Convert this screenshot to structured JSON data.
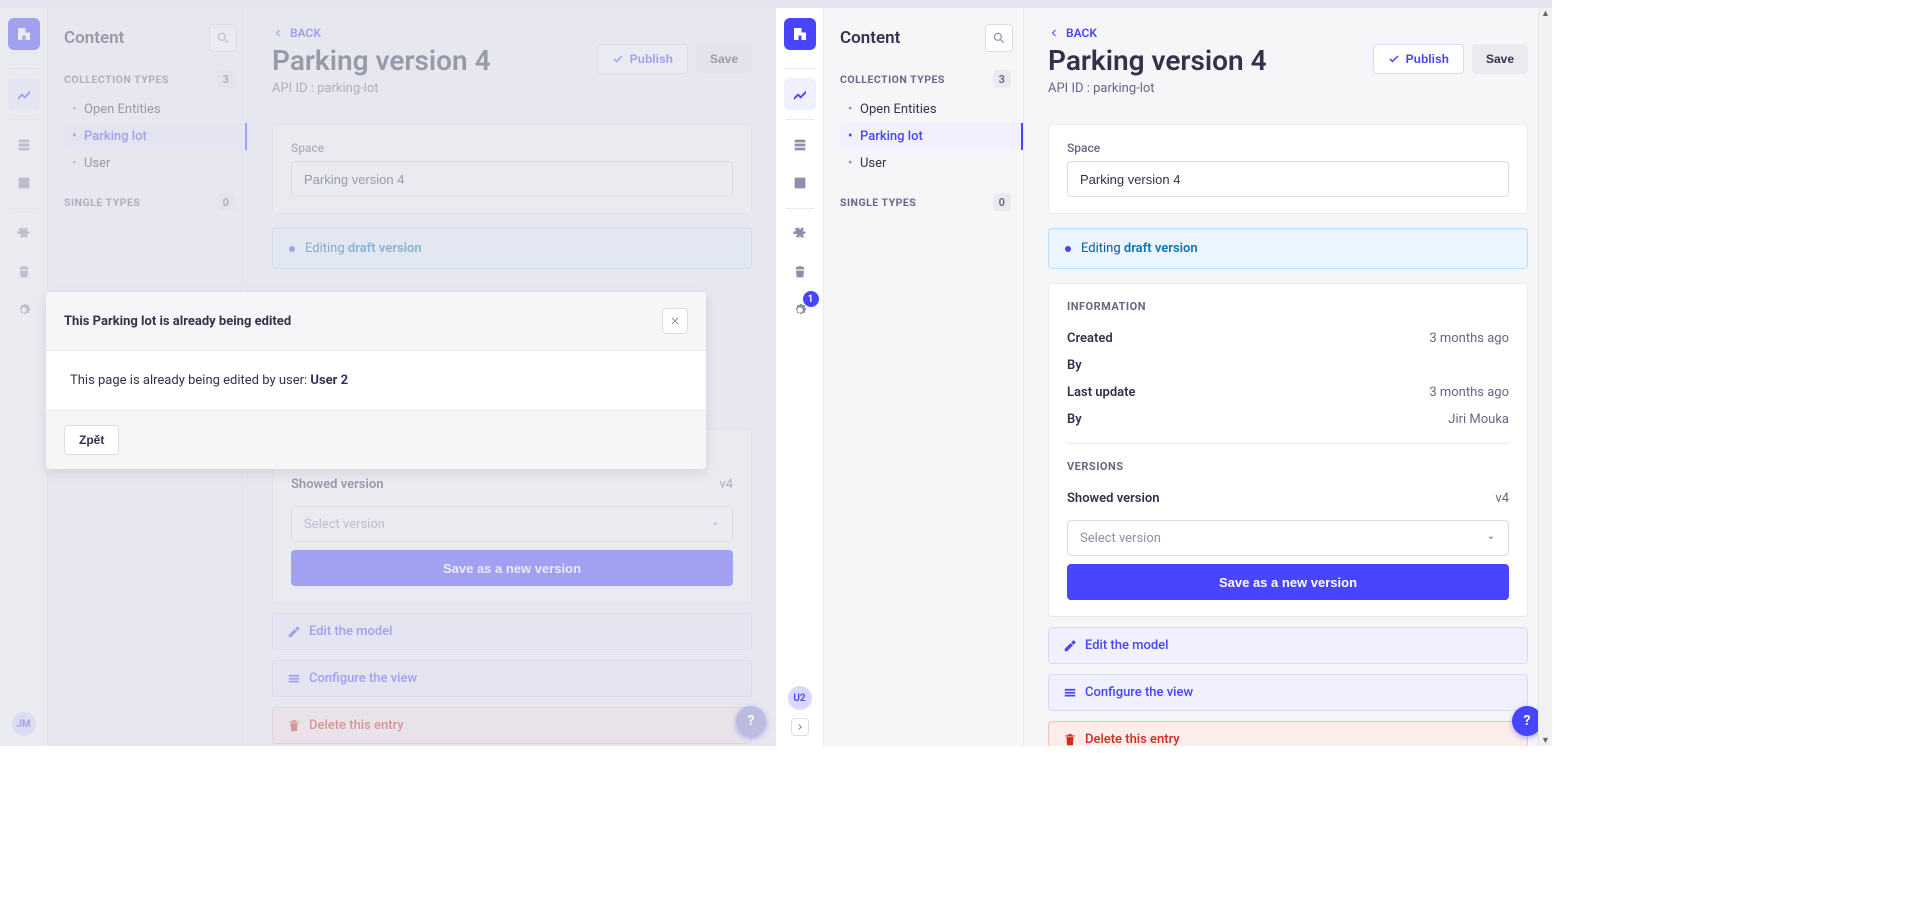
{
  "brand": {
    "color": "#4945ff"
  },
  "sidebar": {
    "title": "Content",
    "sections": {
      "collection": {
        "label": "Collection Types",
        "count": "3"
      },
      "single": {
        "label": "Single Types",
        "count": "0"
      }
    },
    "items": [
      {
        "label": "Open Entities"
      },
      {
        "label": "Parking lot"
      },
      {
        "label": "User"
      }
    ]
  },
  "rail": {
    "settings_badge": "1",
    "left_avatar": "JM",
    "right_avatar": "U2"
  },
  "header": {
    "back": "BACK",
    "title": "Parking version 4",
    "api_id_label": "API ID : ",
    "api_id_value": "parking-lot",
    "publish": "Publish",
    "save": "Save"
  },
  "form": {
    "space_label": "Space",
    "space_value": "Parking version 4"
  },
  "banner": {
    "prefix": "Editing ",
    "status": "draft version"
  },
  "info": {
    "section": "Information",
    "created_label": "Created",
    "created_value": "3 months ago",
    "created_by_label": "By",
    "created_by_value": "",
    "updated_label": "Last update",
    "updated_value": "3 months ago",
    "updated_by_label": "By",
    "updated_by_value": "Jiri Mouka"
  },
  "versions": {
    "section": "Versions",
    "showed_label": "Showed version",
    "showed_value": "v4",
    "select_placeholder": "Select version",
    "save_new": "Save as a new version"
  },
  "actions": {
    "edit_model": "Edit the model",
    "configure_view": "Configure the view",
    "delete_entry": "Delete this entry"
  },
  "modal": {
    "title": "This Parking lot is already being edited",
    "body_prefix": "This page is already being edited by user: ",
    "body_user": "User 2",
    "back_btn": "Zpět"
  },
  "help": "?"
}
